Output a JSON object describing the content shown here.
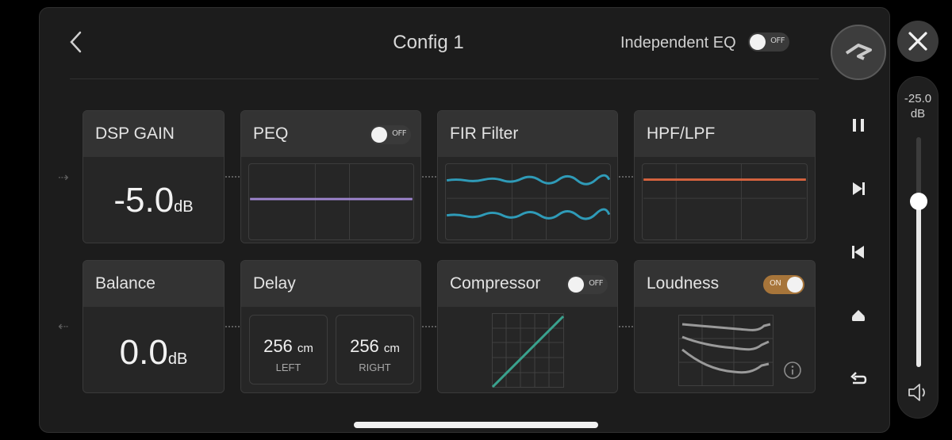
{
  "header": {
    "title": "Config 1",
    "independent_eq_label": "Independent EQ",
    "independent_eq_toggle": "OFF"
  },
  "cards": {
    "dsp_gain": {
      "title": "DSP GAIN",
      "value": "-5.0",
      "unit": "dB"
    },
    "peq": {
      "title": "PEQ",
      "toggle": "OFF"
    },
    "fir": {
      "title": "FIR Filter"
    },
    "hpf_lpf": {
      "title": "HPF/LPF"
    },
    "balance": {
      "title": "Balance",
      "value": "0.0",
      "unit": "dB"
    },
    "delay": {
      "title": "Delay",
      "left": {
        "value": "256",
        "unit": "cm",
        "label": "LEFT"
      },
      "right": {
        "value": "256",
        "unit": "cm",
        "label": "RIGHT"
      }
    },
    "compressor": {
      "title": "Compressor",
      "toggle": "OFF"
    },
    "loudness": {
      "title": "Loudness",
      "toggle": "ON"
    }
  },
  "volume": {
    "line1": "-25.0",
    "line2": "dB",
    "level": 0.72
  },
  "colors": {
    "peq_line": "#9f86d0",
    "fir_line": "#2f9bb8",
    "hpf_line": "#d9643f",
    "compressor_line": "#3aa28e",
    "loudness_toggle": "#a7753a"
  },
  "icons": [
    "back-chevron-icon",
    "logo-icon",
    "close-icon",
    "pause-icon",
    "skip-next-icon",
    "skip-previous-icon",
    "eject-icon",
    "return-icon",
    "speaker-icon",
    "info-icon"
  ]
}
